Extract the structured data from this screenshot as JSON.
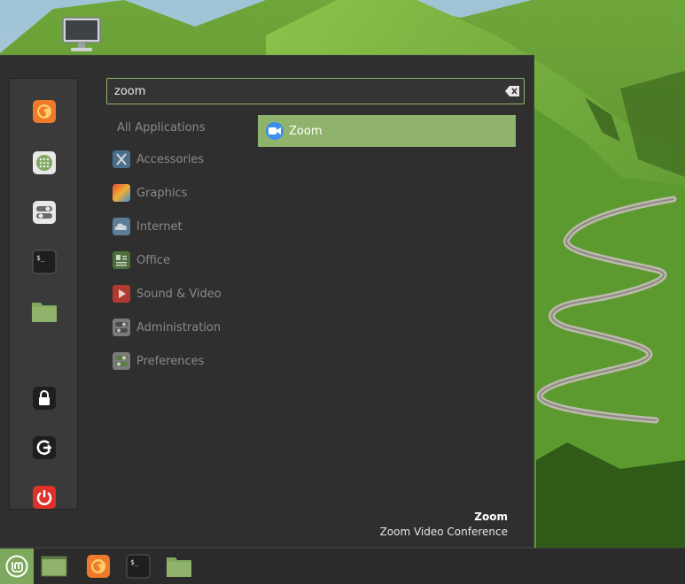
{
  "search": {
    "value": "zoom"
  },
  "categories": [
    {
      "label": "All Applications"
    },
    {
      "label": "Accessories"
    },
    {
      "label": "Graphics"
    },
    {
      "label": "Internet"
    },
    {
      "label": "Office"
    },
    {
      "label": "Sound & Video"
    },
    {
      "label": "Administration"
    },
    {
      "label": "Preferences"
    }
  ],
  "results": [
    {
      "label": "Zoom"
    }
  ],
  "selected_app": {
    "name": "Zoom",
    "description": "Zoom Video Conference"
  },
  "favorites": [
    {
      "icon": "firefox-icon"
    },
    {
      "icon": "software-manager-icon"
    },
    {
      "icon": "settings-icon"
    },
    {
      "icon": "terminal-icon"
    },
    {
      "icon": "files-icon"
    },
    {
      "icon": "lock-icon"
    },
    {
      "icon": "logout-icon"
    },
    {
      "icon": "power-icon"
    }
  ],
  "taskbar": {
    "items": [
      {
        "icon": "show-desktop-icon"
      },
      {
        "icon": "firefox-icon"
      },
      {
        "icon": "terminal-icon"
      },
      {
        "icon": "files-icon"
      }
    ]
  },
  "colors": {
    "accent": "#8fb36a",
    "menu_bg": "#2f2f2f",
    "favbar_bg": "#3a3a3a",
    "power": "#e0302a",
    "firefox": "#f07a2a",
    "zoom_blue": "#3d8cf0"
  }
}
